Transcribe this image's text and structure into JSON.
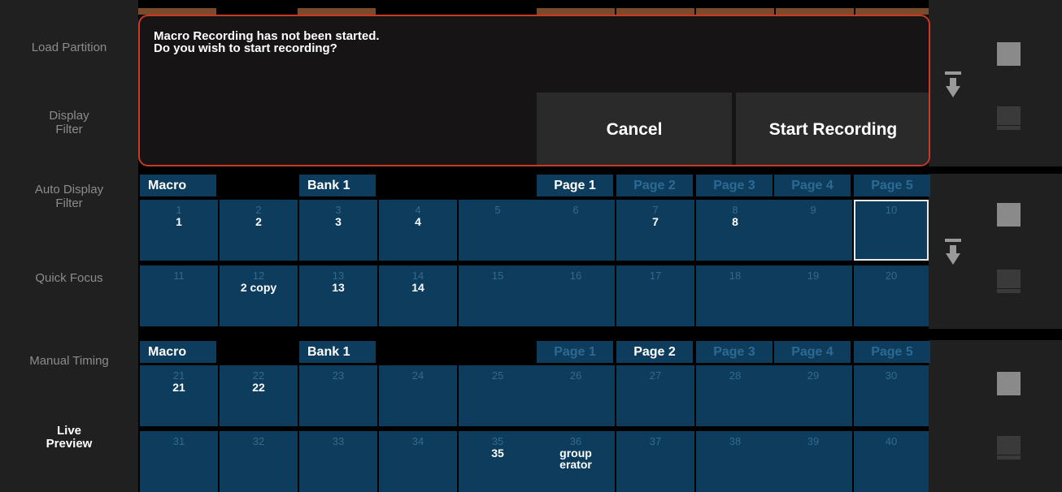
{
  "sidebar": {
    "items": [
      {
        "label": "Load Partition"
      },
      {
        "label": "Display\nFilter"
      },
      {
        "label": "Auto Display\nFilter"
      },
      {
        "label": "Quick Focus"
      },
      {
        "label": "Manual Timing"
      },
      {
        "label": "Live\nPreview"
      }
    ]
  },
  "dialog": {
    "message": "Macro Recording has not been started.\nDo you wish to start recording?",
    "cancel_label": "Cancel",
    "start_label": "Start Recording"
  },
  "bank1": {
    "type_label": "Macro",
    "bank_label": "Bank 1",
    "pages": [
      "Page 1",
      "Page 2",
      "Page 3",
      "Page 4",
      "Page 5"
    ],
    "active_page": 0,
    "cells": [
      {
        "num": "1",
        "label": "1"
      },
      {
        "num": "2",
        "label": "2"
      },
      {
        "num": "3",
        "label": "3"
      },
      {
        "num": "4",
        "label": "4"
      },
      {
        "num": "5",
        "label": ""
      },
      {
        "num": "6",
        "label": ""
      },
      {
        "num": "7",
        "label": "7"
      },
      {
        "num": "8",
        "label": "8"
      },
      {
        "num": "9",
        "label": ""
      },
      {
        "num": "10",
        "label": ""
      },
      {
        "num": "11",
        "label": ""
      },
      {
        "num": "12",
        "label": "2 copy"
      },
      {
        "num": "13",
        "label": "13"
      },
      {
        "num": "14",
        "label": "14"
      },
      {
        "num": "15",
        "label": ""
      },
      {
        "num": "16",
        "label": ""
      },
      {
        "num": "17",
        "label": ""
      },
      {
        "num": "18",
        "label": ""
      },
      {
        "num": "19",
        "label": ""
      },
      {
        "num": "20",
        "label": ""
      }
    ],
    "selected_cell": 9
  },
  "bank2": {
    "type_label": "Macro",
    "bank_label": "Bank 1",
    "pages": [
      "Page 1",
      "Page 2",
      "Page 3",
      "Page 4",
      "Page 5"
    ],
    "active_page": 1,
    "cells": [
      {
        "num": "21",
        "label": "21"
      },
      {
        "num": "22",
        "label": "22"
      },
      {
        "num": "23",
        "label": ""
      },
      {
        "num": "24",
        "label": ""
      },
      {
        "num": "25",
        "label": ""
      },
      {
        "num": "26",
        "label": ""
      },
      {
        "num": "27",
        "label": ""
      },
      {
        "num": "28",
        "label": ""
      },
      {
        "num": "29",
        "label": ""
      },
      {
        "num": "30",
        "label": ""
      },
      {
        "num": "31",
        "label": ""
      },
      {
        "num": "32",
        "label": ""
      },
      {
        "num": "33",
        "label": ""
      },
      {
        "num": "34",
        "label": ""
      },
      {
        "num": "35",
        "label": "35"
      },
      {
        "num": "36",
        "label": "group\nerator"
      },
      {
        "num": "37",
        "label": ""
      },
      {
        "num": "38",
        "label": ""
      },
      {
        "num": "39",
        "label": ""
      },
      {
        "num": "40",
        "label": ""
      }
    ]
  },
  "colors": {
    "cell_bg": "#0d3c5c",
    "dialog_border": "#c83a26",
    "page_inactive": "#2c6a94"
  }
}
